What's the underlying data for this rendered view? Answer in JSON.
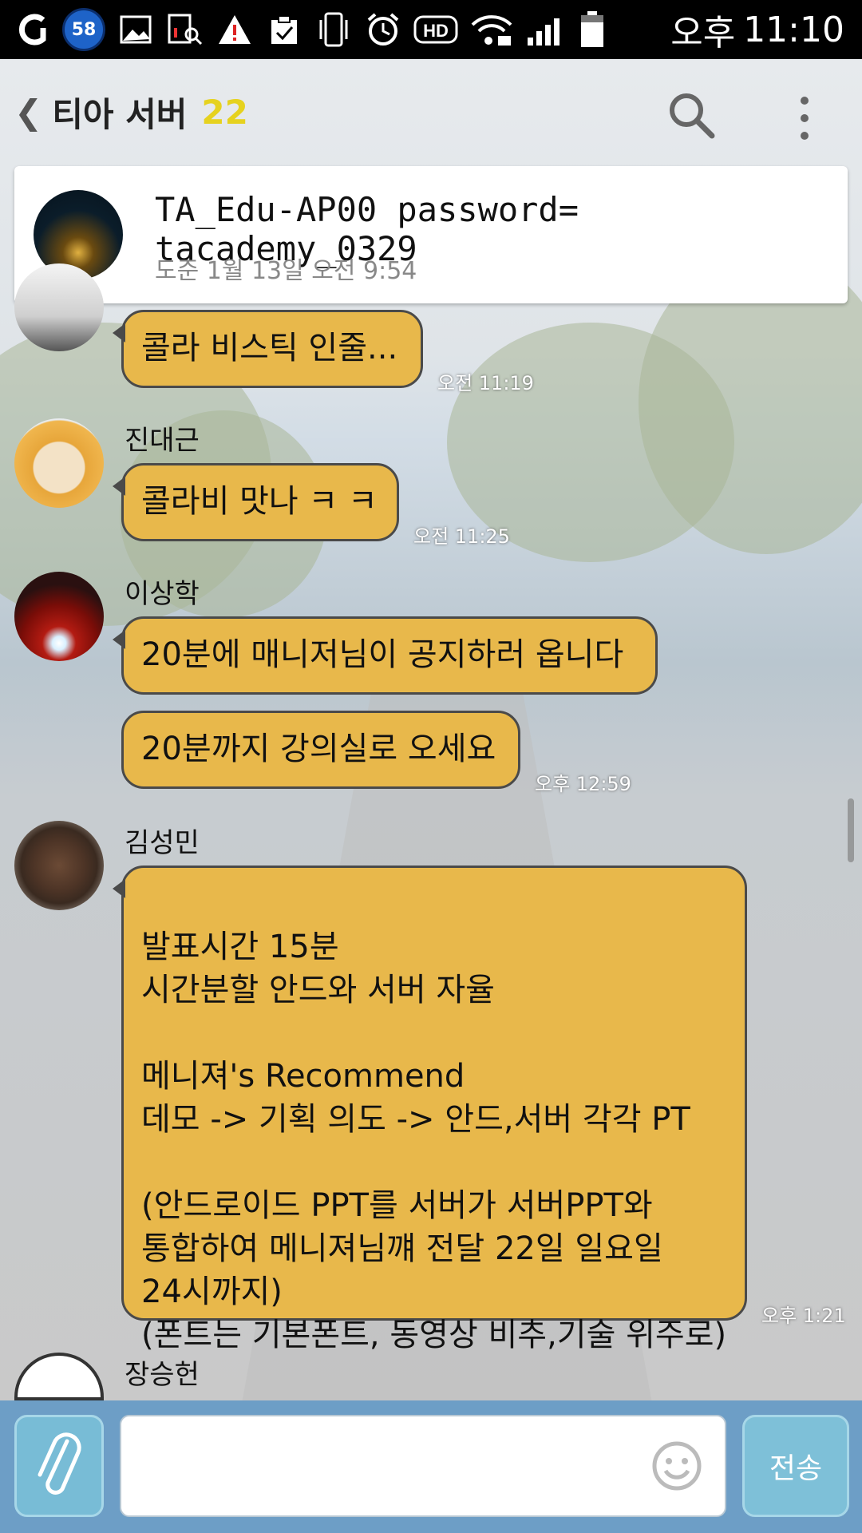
{
  "status_bar": {
    "notification_count": "58",
    "ampm": "오후",
    "time": "11:10",
    "icons": [
      "carrier-icon",
      "notification-count-badge",
      "gallery-icon",
      "screenshot-icon",
      "warning-icon",
      "clipboard-check-icon",
      "vibrate-icon",
      "alarm-icon",
      "hd-icon",
      "wifi-lock-icon",
      "signal-icon",
      "battery-icon"
    ]
  },
  "header": {
    "title": "티아 서버",
    "member_count": "22",
    "icons": [
      "back-chevron-icon",
      "search-icon",
      "more-vert-icon"
    ]
  },
  "notice": {
    "text": "TA_Edu-AP00 password= tacademy_0329",
    "meta": "도준  1월 13일 오전 9:54"
  },
  "messages": [
    {
      "sender": "",
      "text": "콜라 비스틱 인줄...",
      "time": "오전 11:19"
    },
    {
      "sender": "진대근",
      "text": "콜라비 맛나 ㅋ ㅋ",
      "time": "오전 11:25"
    },
    {
      "sender": "이상학",
      "text": "20분에 매니저님이 공지하러 옵니다",
      "time": ""
    },
    {
      "sender": "",
      "text": "20분까지 강의실로 오세요",
      "time": "오후 12:59"
    },
    {
      "sender": "김성민",
      "text": "발표시간 15분\n시간분할 안드와 서버 자율\n\n메니져's Recommend\n데모 -> 기획 의도 -> 안드,서버 각각 PT\n\n(안드로이드 PPT를 서버가 서버PPT와\n통합하여 메니져님꺠 전달 22일 일요일\n24시까지)\n(폰트는 기본폰트, 동영상 비추,기술 위주로)",
      "time": "오후 1:21"
    },
    {
      "sender": "장승헌",
      "text": "",
      "time": ""
    }
  ],
  "input": {
    "send_label": "전송",
    "placeholder": ""
  },
  "colors": {
    "bubble": "#e8b84b",
    "input_bar": "#6d9ec6",
    "accent_count": "#e6d21f"
  }
}
